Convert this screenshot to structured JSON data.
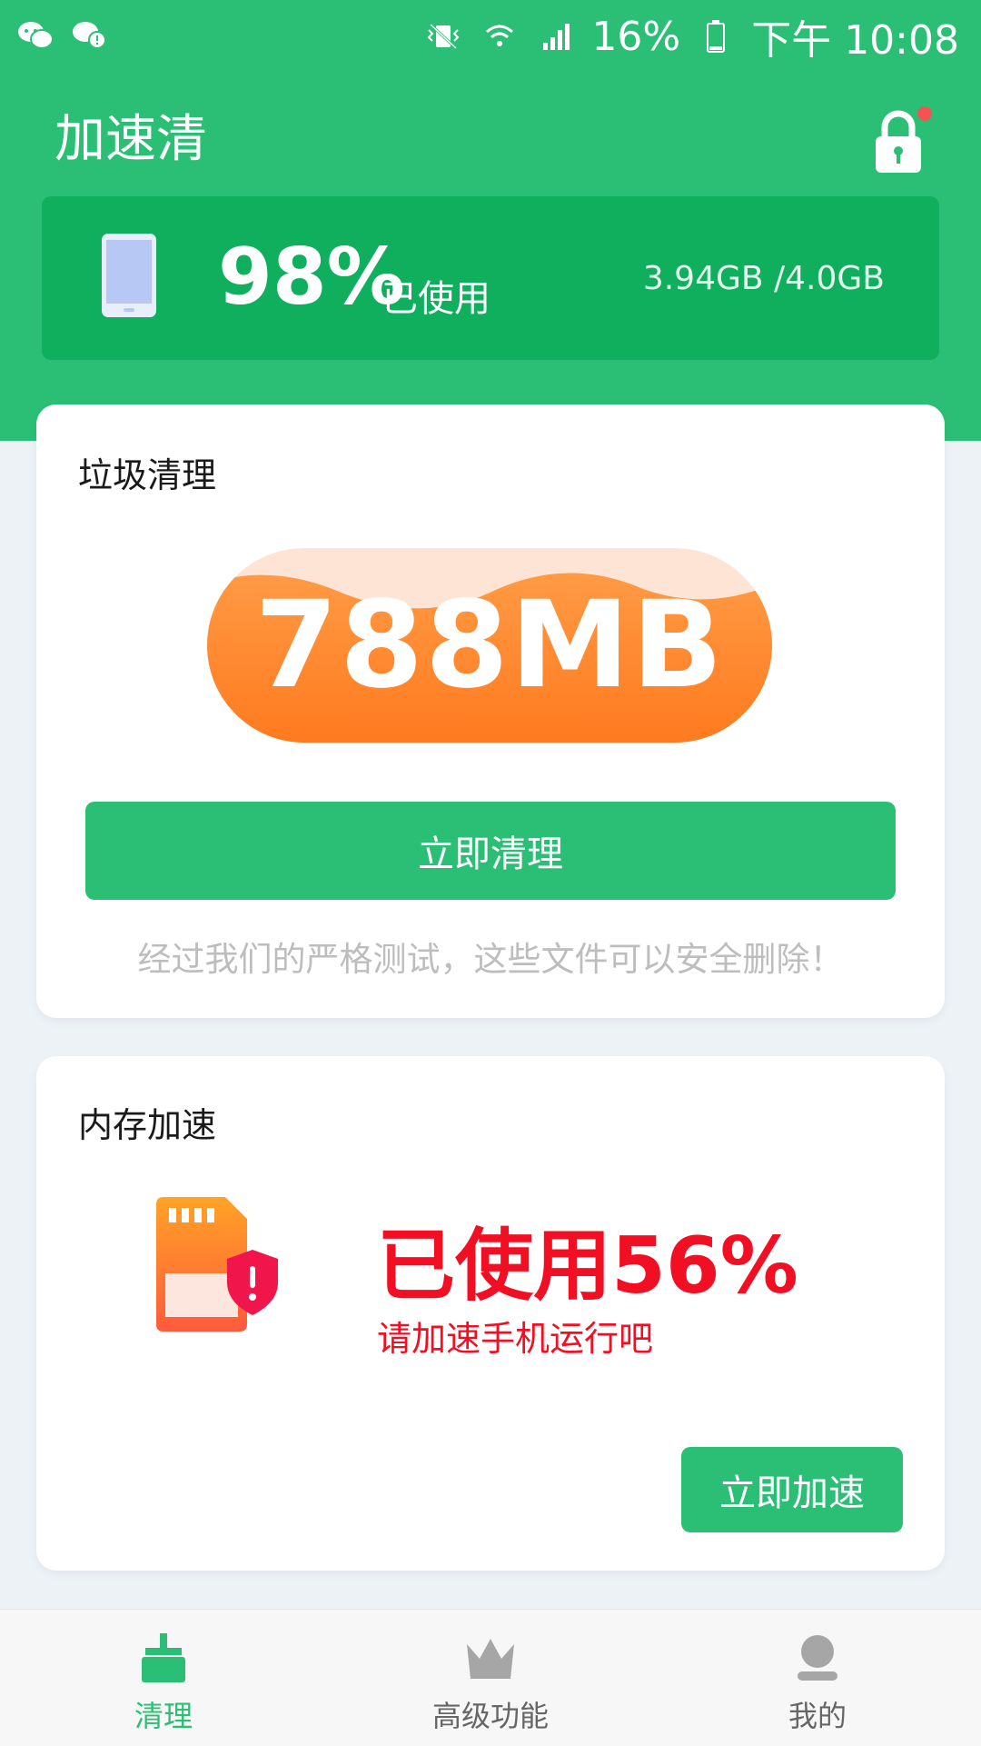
{
  "status_bar": {
    "battery": "16%",
    "time": "下午 10:08",
    "icons": [
      "wechat-icon",
      "wechat-notify-icon",
      "vibrate-icon",
      "wifi-icon",
      "signal-icon",
      "battery-icon"
    ]
  },
  "header": {
    "title": "加速清",
    "lock_icon": "lock-icon"
  },
  "storage": {
    "percent": "98%",
    "used_label": "已使用",
    "detail": "3.94GB /4.0GB"
  },
  "junk_card": {
    "title": "垃圾清理",
    "size": "788MB",
    "button": "立即清理",
    "note": "经过我们的严格测试，这些文件可以安全删除！"
  },
  "memory_card": {
    "title": "内存加速",
    "used": "已使用56%",
    "hint": "请加速手机运行吧",
    "button": "立即加速"
  },
  "bottom_nav": {
    "items": [
      {
        "label": "清理",
        "icon": "broom-icon",
        "active": true
      },
      {
        "label": "高级功能",
        "icon": "crown-icon",
        "active": false
      },
      {
        "label": "我的",
        "icon": "user-icon",
        "active": false
      }
    ]
  },
  "colors": {
    "primary": "#2BBF76",
    "banner": "#10AF5E",
    "alert": "#F20F23",
    "junk_orange": "#FF8A2B",
    "nav_inactive": "#9E9E9E"
  }
}
